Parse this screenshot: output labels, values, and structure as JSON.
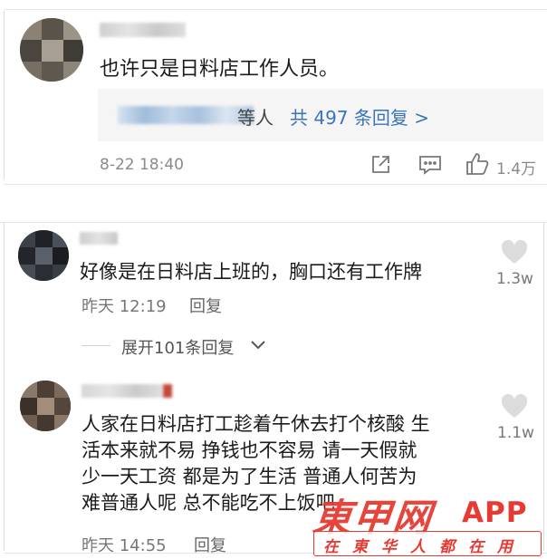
{
  "comment_top": {
    "text": "也许只是日料店工作人员。",
    "replies_suffix": "等人",
    "replies_link": "共 497 条回复 >",
    "timestamp": "8-22 18:40",
    "like_count": "1.4万"
  },
  "comment_1": {
    "text": "好像是在日料店上班的，胸口还有工作牌",
    "timestamp": "昨天 12:19",
    "reply_label": "回复",
    "like_count": "1.3w",
    "expand_label": "展开101条回复"
  },
  "comment_2": {
    "text_lines": [
      "人家在日料店打工趁着午休去打个核酸 生",
      "活本来就不易 挣钱也不容易 请一天假就",
      "少一天工资 都是为了生活 普通人何苦为",
      "难普通人呢 总不能吃不上饭吧"
    ],
    "timestamp": "昨天 14:55",
    "reply_label": "回复",
    "like_count": "1.1w"
  },
  "watermark": {
    "brand": "東甲网",
    "app": "APP",
    "slogan": "在東华人都在用",
    "color": "#e63a32"
  }
}
